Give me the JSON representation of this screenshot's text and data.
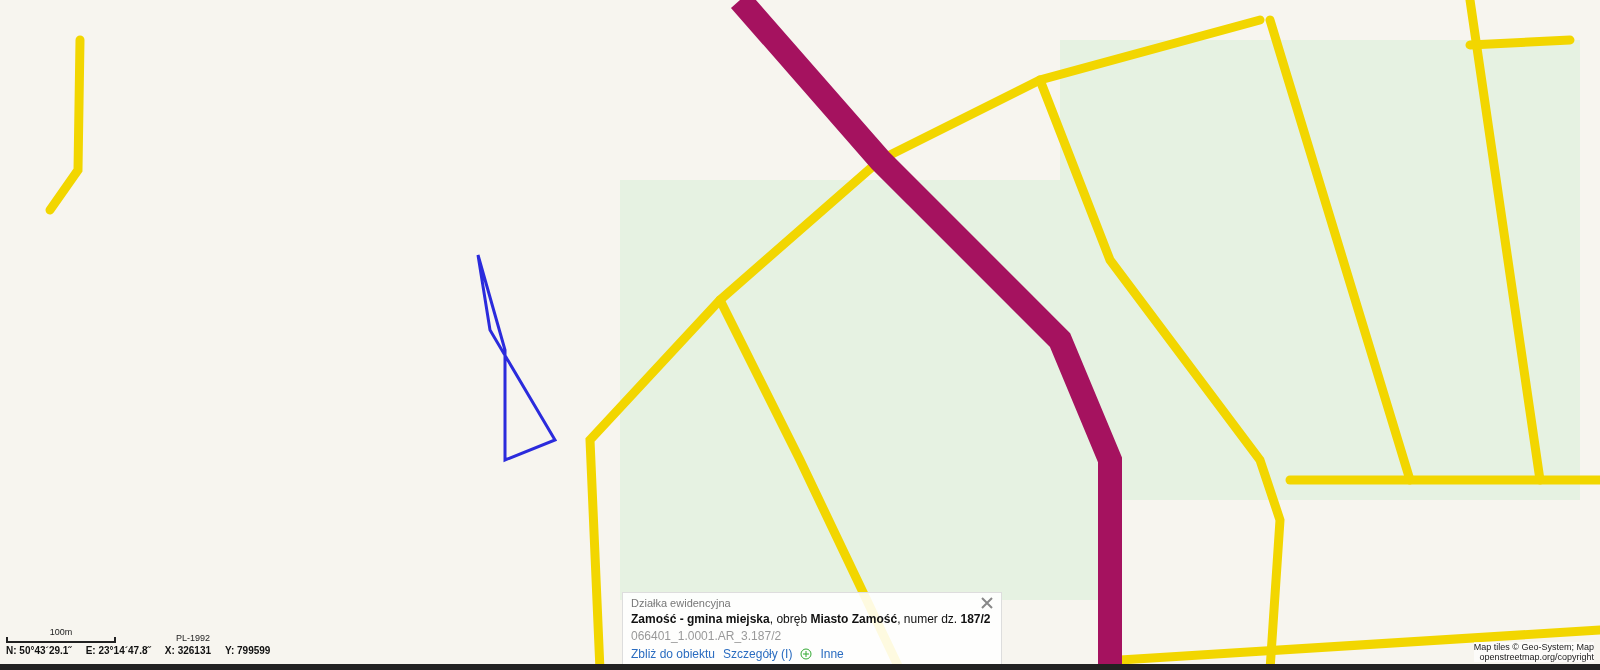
{
  "popup": {
    "title": "Działka ewidencyjna",
    "description": "**Zamość - gmina miejska**, obręb **Miasto Zamość**, numer dz. **187/2**",
    "identifier": "066401_1.0001.AR_3.187/2",
    "links": [
      "Zbliż do obiektu",
      "Szczegóły (I)",
      "Inne"
    ]
  },
  "scale": {
    "label": "100m",
    "crs": "PL-1992"
  },
  "coordinates": [
    "N: 50°43´29.1˝",
    "E: 23°14´47.8˝",
    "X: 326131",
    "Y: 799599"
  ],
  "attribution": [
    "Map tiles © Geo-System; Map",
    "openstreetmap.org/copyright"
  ]
}
